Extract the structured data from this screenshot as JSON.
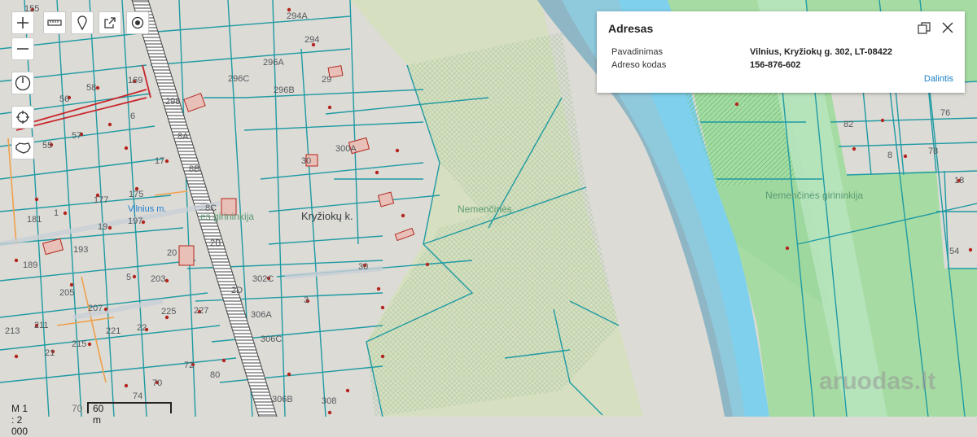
{
  "map": {
    "labels": {
      "l294a": "294A",
      "l294": "294",
      "l296a": "296A",
      "l296c": "296C",
      "l296b": "296B",
      "l29x": "29",
      "l298": "298",
      "l8a": "8A",
      "l8b": "8B",
      "l8c": "8C",
      "l2b": "2B",
      "l2d": "2D",
      "l300a": "300A",
      "l30": "30",
      "l30b": "30",
      "l302c": "302C",
      "l306a": "306A",
      "l306c": "306C",
      "l306b": "306B",
      "l308": "308",
      "l3x": "3",
      "l155": "155",
      "l169": "169",
      "l58": "58",
      "l56": "56",
      "l6x": "6",
      "l57": "57",
      "l55": "55",
      "l17": "17",
      "l177": "177",
      "l175": "175",
      "l181": "181",
      "l1x": "1",
      "l195": "19",
      "l197": "197",
      "l193": "193",
      "l189": "189",
      "l20x": "20",
      "l203": "203",
      "l205": "205",
      "l207": "207",
      "l5x": "5",
      "l225": "225",
      "l227": "227",
      "l221": "221",
      "l22x": "22",
      "l211": "211",
      "l213": "213",
      "l21x": "21",
      "l215": "215",
      "l72": "72",
      "l80": "80",
      "l74": "74",
      "l70x": "70",
      "l76": "76",
      "l82": "82",
      "l78": "78",
      "l54": "54",
      "l8x": "8",
      "l18x": "18"
    },
    "place_neris": "Nemenčinės",
    "place_girininkija_right": "Nemenčinės girininkija",
    "place_girininkija_left": "ės girininkija",
    "place_kryziokai": "Kryžiokų k.",
    "place_vilnius": "Vilnius m."
  },
  "toolbar": {
    "zoom_in_icon": "plus-icon",
    "zoom_out_icon": "minus-icon",
    "measure_icon": "ruler-icon",
    "marker_icon": "pin-icon",
    "share_icon": "share-icon",
    "locate_icon": "target-icon",
    "compass_icon": "compass-icon",
    "gps_icon": "crosshair-icon",
    "area_icon": "lithuania-map-icon"
  },
  "popup": {
    "title": "Adresas",
    "row1_label": "Pavadinimas",
    "row1_value": "Vilnius, Kryžiokų g. 302, LT-08422",
    "row2_label": "Adreso kodas",
    "row2_value": "156-876-602",
    "share_link": "Dalintis"
  },
  "scale": {
    "ratio": "M 1 : 2 000",
    "small": "70",
    "distance": "60 m"
  },
  "watermark": "aruodas.lt",
  "colors": {
    "parcel_line": "#1f9aa3",
    "river": "#7fcfe8",
    "river_dark": "#8fb0c0",
    "forest": "#9ed89f",
    "green_area": "#c7dbb1",
    "building_dot": "#b3261e",
    "link": "#1b7fc4"
  }
}
